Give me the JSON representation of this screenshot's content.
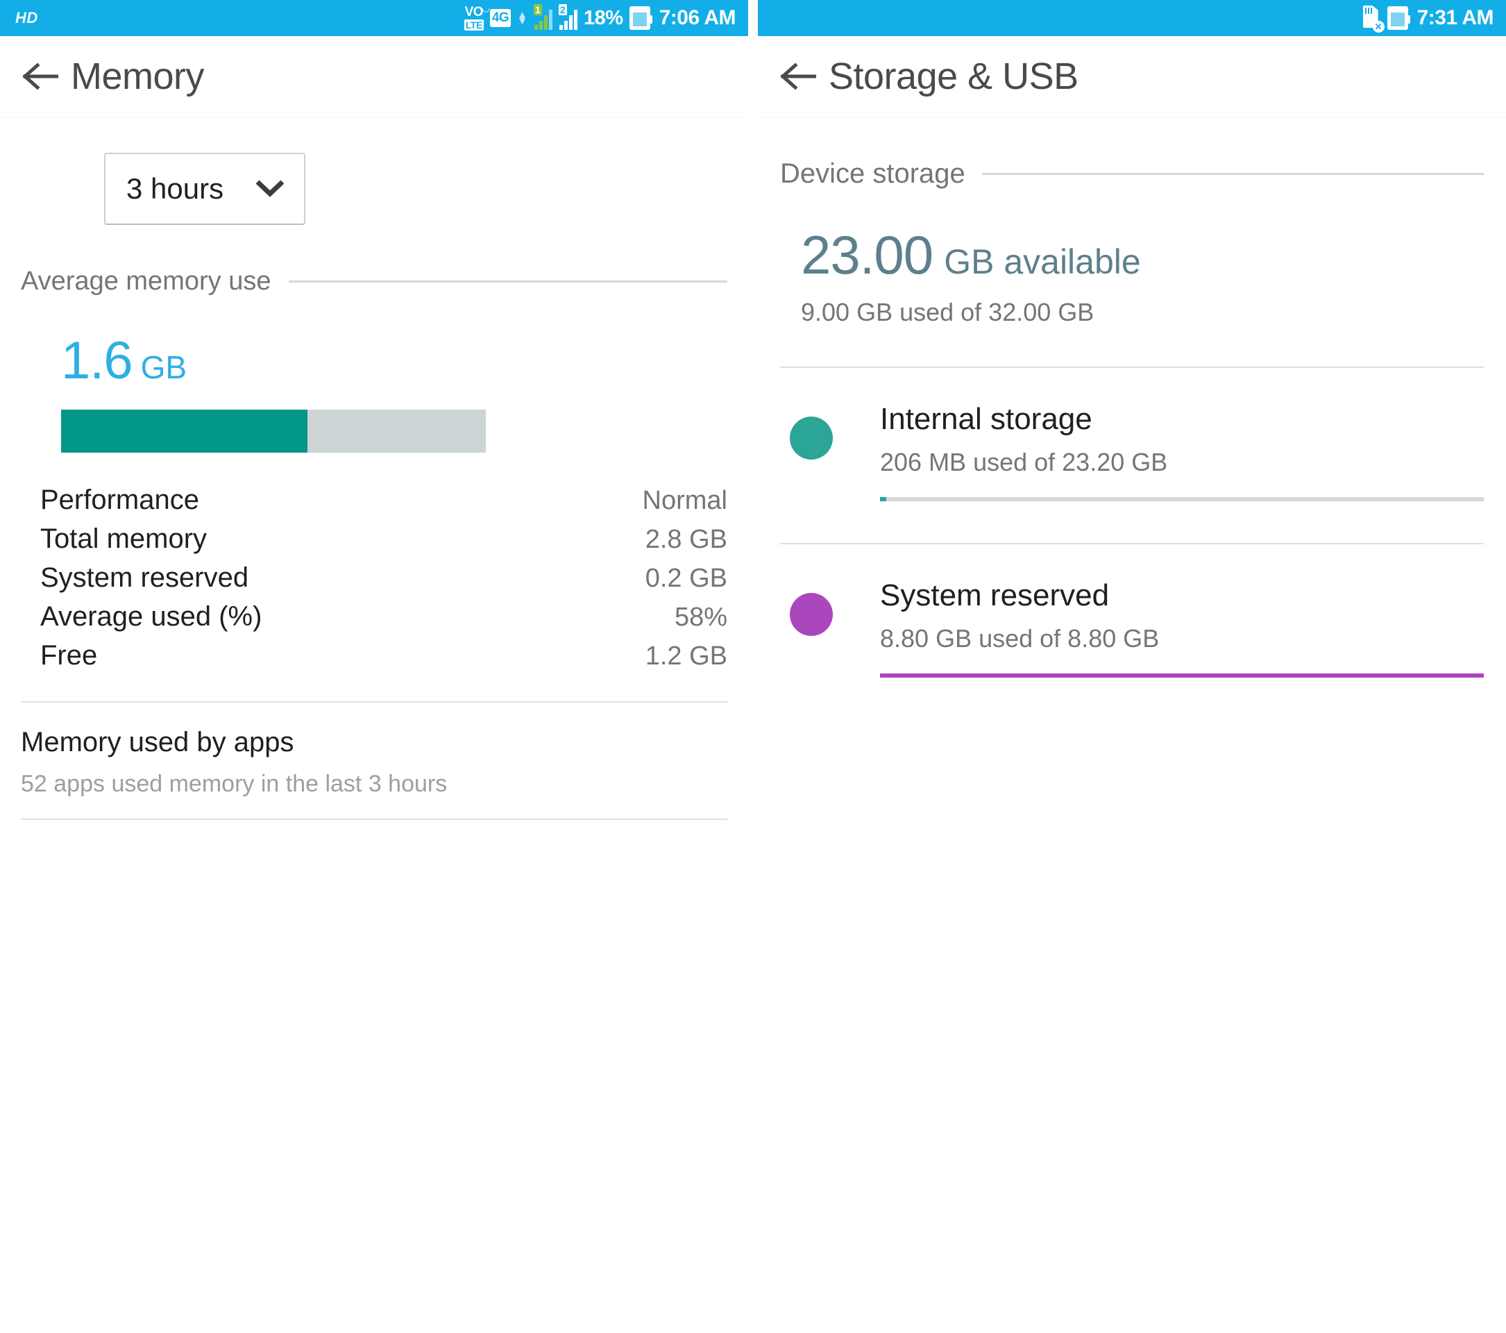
{
  "left": {
    "status_bar": {
      "hd_label": "HD",
      "volte_label": "VO",
      "lte_label": "LTE",
      "network_label": "4G",
      "sim1_label": "1",
      "sim2_label": "2",
      "battery_percent": "18%",
      "clock": "7:06 AM",
      "icons": [
        "volte-icon",
        "4g-icon",
        "data-arrows-icon",
        "sim1-signal-icon",
        "sim2-signal-icon",
        "battery-icon"
      ]
    },
    "appbar": {
      "title": "Memory",
      "back_icon": "back-arrow-icon"
    },
    "spinner": {
      "value": "3 hours",
      "chevron_icon": "chevron-down-icon"
    },
    "average_section": {
      "header": "Average memory use",
      "value_number": "1.6",
      "value_unit": "GB",
      "bar_fill_percent": 58,
      "bar_fill_color": "#009688",
      "bar_track_color": "#ccd4d6"
    },
    "stats": [
      {
        "label": "Performance",
        "value": "Normal"
      },
      {
        "label": "Total memory",
        "value": "2.8 GB"
      },
      {
        "label": "System reserved",
        "value": "0.2 GB"
      },
      {
        "label": "Average used (%)",
        "value": "58%"
      },
      {
        "label": "Free",
        "value": "1.2 GB"
      }
    ],
    "apps_section": {
      "title": "Memory used by apps",
      "subtitle": "52 apps used memory in the last 3 hours"
    }
  },
  "right": {
    "status_bar": {
      "clock": "7:31 AM",
      "icons": [
        "sd-card-removed-icon",
        "battery-icon"
      ]
    },
    "appbar": {
      "title": "Storage & USB",
      "back_icon": "back-arrow-icon"
    },
    "device_section": {
      "header": "Device storage",
      "available_number": "23.00",
      "available_unit": "GB available",
      "used_of": "9.00 GB used of 32.00 GB"
    },
    "storage_items": [
      {
        "name": "Internal storage",
        "detail": "206 MB used of 23.20 GB",
        "dot_color": "#2BA596",
        "progress_color": "#2BA596",
        "progress_percent": 1
      },
      {
        "name": "System reserved",
        "detail": "8.80 GB used of 8.80 GB",
        "dot_color": "#AB47BC",
        "progress_color": "#AB47BC",
        "progress_percent": 100
      }
    ]
  },
  "theme": {
    "status_bar_color": "#13AEE8",
    "accent_blue": "#2EAFE4",
    "slate": "#5E7F8C",
    "teal": "#009688",
    "purple": "#AB47BC"
  }
}
